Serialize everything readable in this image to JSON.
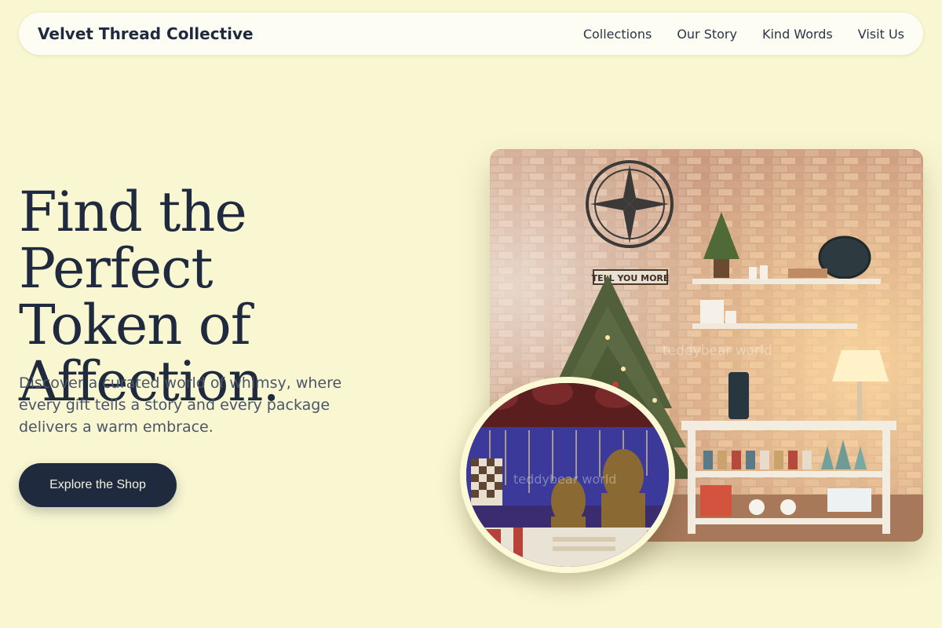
{
  "brand": {
    "name": "Velvet Thread Collective"
  },
  "nav": {
    "items": [
      {
        "label": "Collections"
      },
      {
        "label": "Our Story"
      },
      {
        "label": "Kind Words"
      },
      {
        "label": "Visit Us"
      }
    ]
  },
  "hero": {
    "title_line1": "Find the Perfect",
    "title_line2": "Token of",
    "title_line3": "Affection.",
    "description": "Discover a curated world of whimsy, where every gift tells a story and every package delivers a warm embrace.",
    "cta_label": "Explore the Shop"
  },
  "images": {
    "main_sign_text": "TELL YOU MORE",
    "main_watermark": "teddybear world",
    "circle_watermark": "teddybear world"
  },
  "colors": {
    "background": "#f9f7d2",
    "navy": "#1f2a3e",
    "nav_bg": "#fdfdf3",
    "body_text": "#4a5568"
  }
}
